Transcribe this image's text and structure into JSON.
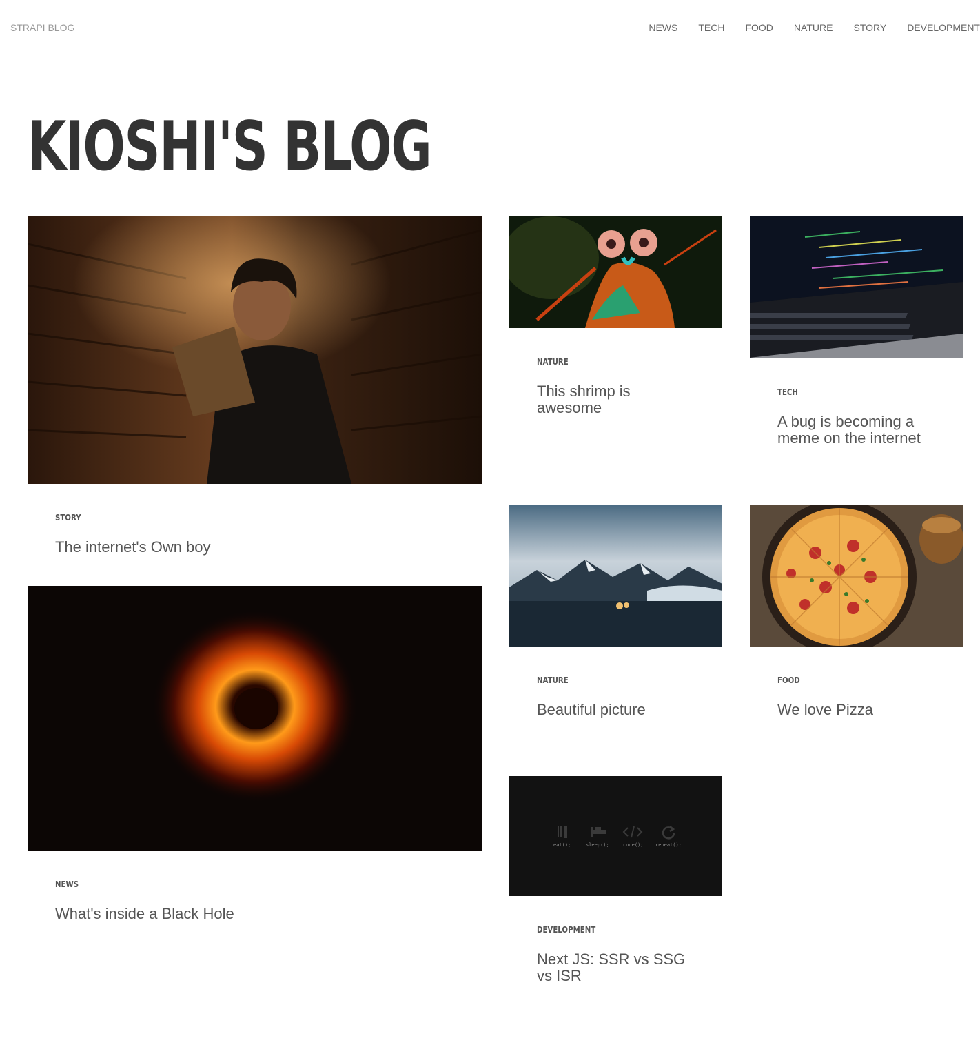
{
  "header": {
    "brand": "STRAPI BLOG",
    "nav": [
      "NEWS",
      "TECH",
      "FOOD",
      "NATURE",
      "STORY",
      "DEVELOPMENT"
    ]
  },
  "page_title": "KIOSHI'S BLOG",
  "articles": [
    {
      "category": "STORY",
      "title": "The internet's Own boy",
      "image": "man-reading-in-bookstore"
    },
    {
      "category": "NEWS",
      "title": "What's inside a Black Hole",
      "image": "black-hole"
    },
    {
      "category": "NATURE",
      "title": "This shrimp is awesome",
      "image": "mantis-shrimp"
    },
    {
      "category": "TECH",
      "title": "A bug is becoming a meme on the internet",
      "image": "laptop-code"
    },
    {
      "category": "NATURE",
      "title": "Beautiful picture",
      "image": "mountains-landscape"
    },
    {
      "category": "FOOD",
      "title": "We love Pizza",
      "image": "pizza"
    },
    {
      "category": "DEVELOPMENT",
      "title": "Next JS: SSR vs SSG vs ISR",
      "image": "eat-sleep-code-repeat"
    }
  ],
  "dev_image_labels": [
    "eat();",
    "sleep();",
    "code();",
    "repeat();"
  ],
  "colors": {
    "text": "#333333",
    "muted": "#999999",
    "body": "#555555"
  }
}
